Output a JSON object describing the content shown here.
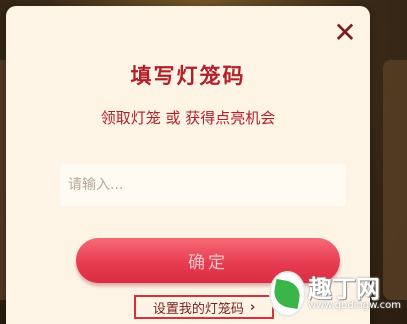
{
  "dialog": {
    "close_glyph": "✕",
    "title": "填写灯笼码",
    "subtitle": "领取灯笼 或 获得点亮机会",
    "input_placeholder": "请输入...",
    "input_value": "",
    "confirm_label": "确定",
    "set_link_label": "设置我的灯笼码",
    "set_link_chevron": "›"
  },
  "watermark": {
    "name": "趣丁网",
    "url": "www.qudingw.com"
  },
  "colors": {
    "accent_red": "#b3202a",
    "button_red": "#e63a4e",
    "dialog_bg": "#fdf4e6",
    "link_border": "#d9303a"
  }
}
